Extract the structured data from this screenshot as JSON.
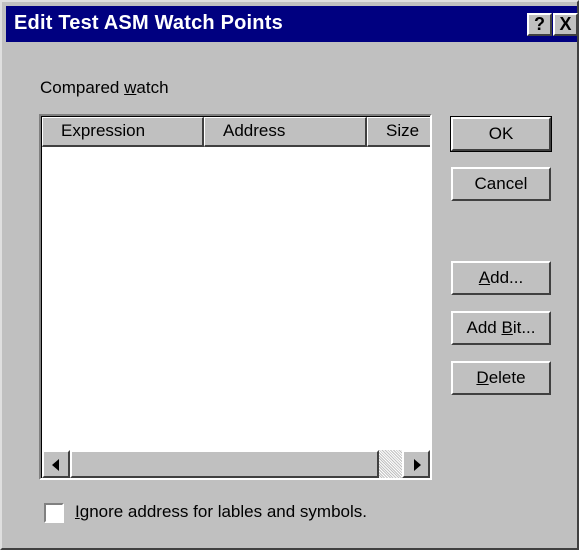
{
  "window": {
    "title": "Edit Test ASM Watch Points",
    "help_label": "?",
    "close_label": "X"
  },
  "watch_list": {
    "label_before": "Compared ",
    "label_mnemonic": "w",
    "label_after": "atch",
    "columns": [
      "Expression",
      "Address",
      "Size"
    ],
    "rows": []
  },
  "buttons": {
    "ok": {
      "before": "",
      "mnemonic": "",
      "after": "OK"
    },
    "cancel": {
      "before": "",
      "mnemonic": "",
      "after": "Cancel"
    },
    "add": {
      "before": "",
      "mnemonic": "A",
      "after": "dd..."
    },
    "add_bit": {
      "before": "Add ",
      "mnemonic": "B",
      "after": "it..."
    },
    "delete": {
      "before": "",
      "mnemonic": "D",
      "after": "elete"
    }
  },
  "ignore_address": {
    "checked": false,
    "mnemonic": "I",
    "after": "gnore address for lables and symbols."
  }
}
